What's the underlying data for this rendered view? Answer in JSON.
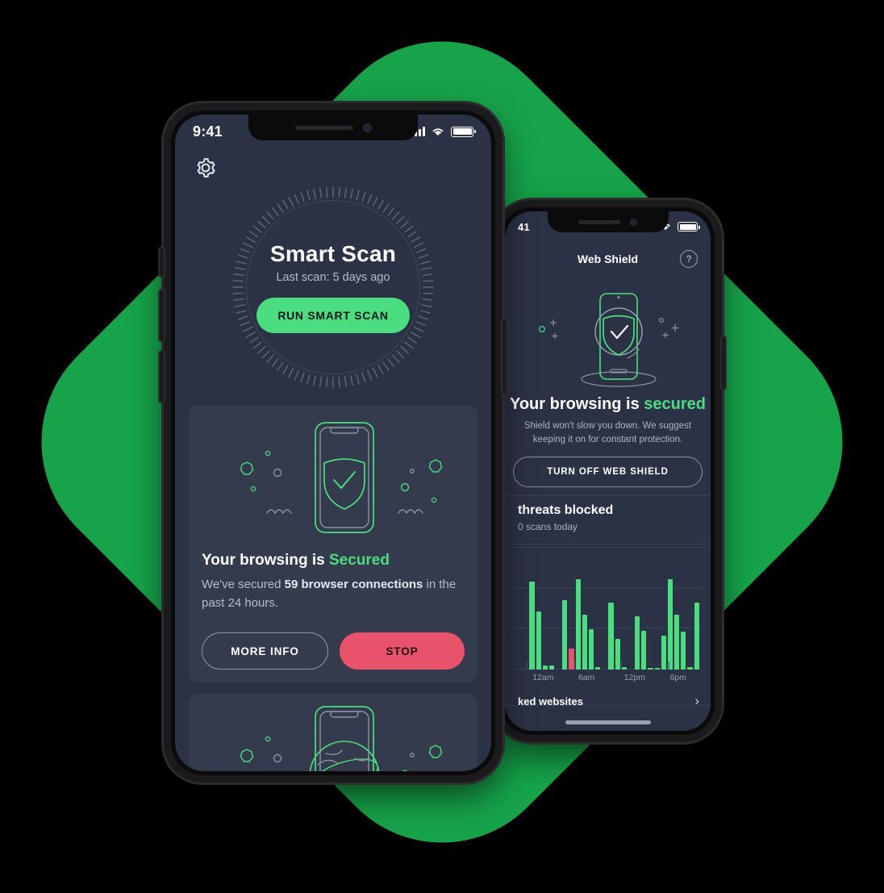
{
  "theme": {
    "background": "#000000",
    "accent_green": "#16a34a",
    "bright_green": "#4ade80",
    "danger_red": "#e8536b",
    "screen_bg": "#2b3245",
    "card_bg": "#343b4d"
  },
  "front_phone": {
    "status_bar": {
      "time": "9:41",
      "signal_icon": "cellular-bars-icon",
      "wifi_icon": "wifi-icon",
      "battery_icon": "battery-full-icon"
    },
    "settings_icon": "gear-icon",
    "smart_scan": {
      "title": "Smart Scan",
      "subtitle": "Last scan: 5 days ago",
      "button_label": "RUN SMART SCAN"
    },
    "browsing_card": {
      "illustration": "phone-with-shield-check-icon",
      "heading_prefix": "Your browsing is ",
      "heading_status": "Secured",
      "body_prefix": "We've secured ",
      "body_highlight": "59 browser connections",
      "body_suffix": " in the past 24 hours.",
      "more_info_label": "MORE INFO",
      "stop_label": "STOP"
    },
    "wifi_card": {
      "illustration": "phone-with-wifi-globe-icon"
    }
  },
  "back_phone": {
    "status_bar": {
      "time": "41",
      "signal_icon": "cellular-bars-icon",
      "wifi_icon": "wifi-icon",
      "battery_icon": "battery-full-icon"
    },
    "header": {
      "title": "Web Shield",
      "help_icon": "question-mark-circle-icon",
      "help_label": "?"
    },
    "illustration": "phone-shield-scan-icon",
    "status": {
      "heading_prefix": "Your browsing is ",
      "heading_status": "secured",
      "description": "Shield won't slow you down. We suggest keeping it on for constant protection."
    },
    "turn_off_button": "TURN OFF WEB SHIELD",
    "threats": {
      "title": "threats blocked",
      "subtitle": "0 scans today"
    },
    "bottom_row": {
      "label": "ked websites",
      "chevron_icon": "chevron-right-icon",
      "chevron_glyph": "›"
    }
  },
  "chart_data": {
    "type": "bar",
    "title": "threats blocked",
    "subtitle": "0 scans today",
    "xlabel": "",
    "ylabel": "",
    "grid": true,
    "legend_position": "none",
    "ylim": [
      0,
      100
    ],
    "tick_labels": [
      "12am",
      "6am",
      "12pm",
      "6pm"
    ],
    "tick_positions": [
      2,
      9,
      16,
      23
    ],
    "colors": {
      "normal": "#4ade80",
      "threat": "#e8536b"
    },
    "categories": [
      "0",
      "1",
      "2",
      "3",
      "4",
      "5",
      "6",
      "7",
      "8",
      "9",
      "10",
      "11",
      "12",
      "13",
      "14",
      "15",
      "16",
      "17",
      "18",
      "19",
      "20",
      "21",
      "22",
      "23",
      "24",
      "25",
      "26",
      "27"
    ],
    "values": [
      0,
      0,
      72,
      48,
      3,
      3,
      0,
      57,
      17,
      74,
      45,
      33,
      2,
      0,
      55,
      25,
      2,
      0,
      44,
      32,
      1,
      1,
      28,
      74,
      45,
      31,
      2,
      55
    ],
    "bar_types": [
      "none",
      "none",
      "normal",
      "normal",
      "normal",
      "normal",
      "none",
      "normal",
      "threat",
      "normal",
      "normal",
      "normal",
      "normal",
      "none",
      "normal",
      "normal",
      "normal",
      "none",
      "normal",
      "normal",
      "normal",
      "normal",
      "normal",
      "normal",
      "normal",
      "normal",
      "normal",
      "normal"
    ]
  }
}
